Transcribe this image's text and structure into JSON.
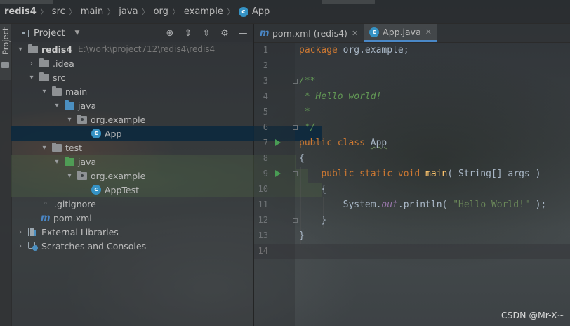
{
  "breadcrumb": [
    "redis4",
    "src",
    "main",
    "java",
    "org",
    "example",
    "App"
  ],
  "stripe": {
    "label": "Project"
  },
  "panel": {
    "title": "Project"
  },
  "tree": [
    {
      "label": "redis4",
      "path": "E:\\work\\project712\\redis4\\redis4",
      "icon": "module-folder-icon",
      "expanded": true
    },
    {
      "label": ".idea",
      "icon": "folder-icon",
      "expanded": false
    },
    {
      "label": "src",
      "icon": "folder-icon",
      "expanded": true
    },
    {
      "label": "main",
      "icon": "folder-icon",
      "expanded": true
    },
    {
      "label": "java",
      "icon": "source-root-folder-icon",
      "expanded": true
    },
    {
      "label": "org.example",
      "icon": "package-icon",
      "expanded": true
    },
    {
      "label": "App",
      "icon": "java-class-icon",
      "selected": true
    },
    {
      "label": "test",
      "icon": "folder-icon",
      "expanded": true
    },
    {
      "label": "java",
      "icon": "test-root-folder-icon",
      "expanded": true
    },
    {
      "label": "org.example",
      "icon": "package-icon",
      "expanded": true
    },
    {
      "label": "AppTest",
      "icon": "java-class-icon"
    },
    {
      "label": ".gitignore",
      "icon": "gitignore-icon"
    },
    {
      "label": "pom.xml",
      "icon": "maven-icon"
    },
    {
      "label": "External Libraries",
      "icon": "libraries-icon",
      "expanded": false
    },
    {
      "label": "Scratches and Consoles",
      "icon": "scratches-icon",
      "expanded": false
    }
  ],
  "tabs": [
    {
      "label": "pom.xml (redis4)",
      "icon": "maven-icon",
      "active": false
    },
    {
      "label": "App.java",
      "icon": "java-class-icon",
      "active": true
    }
  ],
  "editor": {
    "line_numbers": [
      "1",
      "2",
      "3",
      "4",
      "5",
      "6",
      "7",
      "8",
      "9",
      "10",
      "11",
      "12",
      "13",
      "14"
    ],
    "current_line": 14
  },
  "code": {
    "l1_kw": "package",
    "l1_rest": " org.example;",
    "l3": "/**",
    "l4": " * Hello world!",
    "l5": " *",
    "l6": " */",
    "l7_kw": "public class",
    "l7_name": "App",
    "l8": "{",
    "l9_kw": "public static void",
    "l9_fn": "main",
    "l9_rest": "( String[] args )",
    "l10": "{",
    "l11_a": "System.",
    "l11_field": "out",
    "l11_b": ".println( ",
    "l11_str": "\"Hello World!\"",
    "l11_c": " );",
    "l12": "}",
    "l13": "}"
  },
  "watermark": "CSDN @Mr-X~",
  "colors": {
    "keyword": "#cc7832",
    "comment": "#629755",
    "string": "#6a8759",
    "method": "#ffc66d",
    "selection": "#0d293e",
    "accent": "#4a88c7"
  }
}
